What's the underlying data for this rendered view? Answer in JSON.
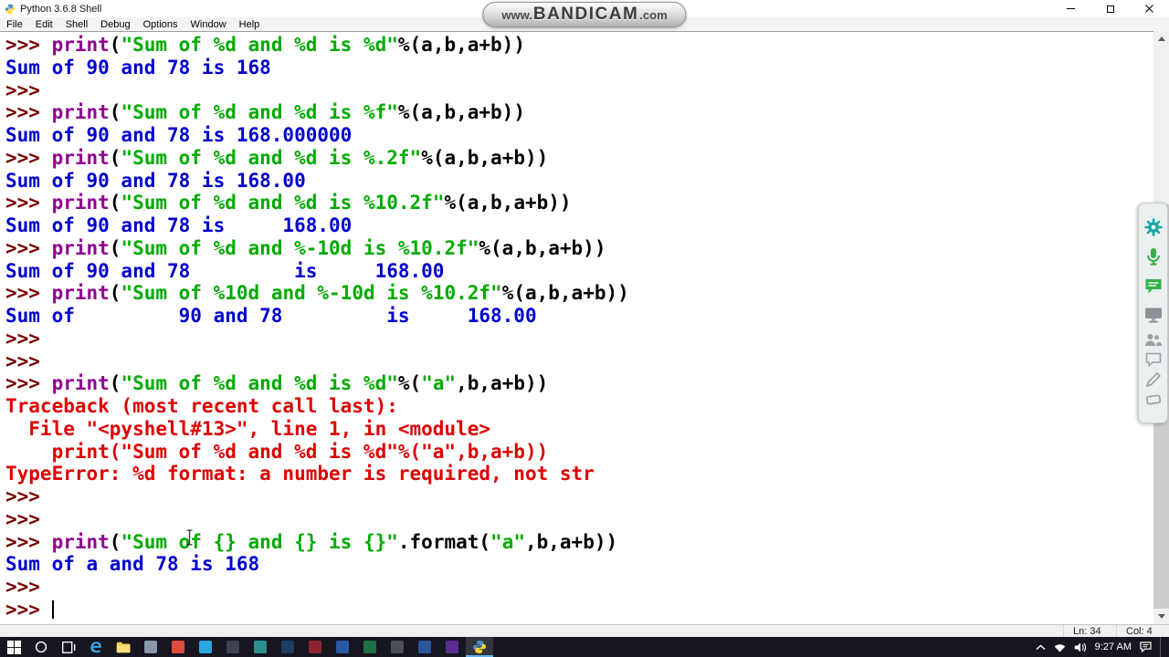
{
  "window": {
    "title": "Python 3.6.8 Shell"
  },
  "menu": {
    "items": [
      "File",
      "Edit",
      "Shell",
      "Debug",
      "Options",
      "Window",
      "Help"
    ]
  },
  "watermark": {
    "prefix": "www.",
    "brand": "BANDICAM",
    "suffix": ".com"
  },
  "colors": {
    "prompt": "#770000",
    "builtin": "#900090",
    "string": "#00aa00",
    "stdout": "#0000cd",
    "stderr": "#dd0000",
    "plain": "#000000",
    "taskbar_bg": "#161621",
    "accent_active": "#5fb2e8"
  },
  "shell": {
    "cursor_line": 25,
    "lines": [
      [
        {
          "t": ">>> ",
          "c": "p"
        },
        {
          "t": "print",
          "c": "b"
        },
        {
          "t": "(",
          "c": "n"
        },
        {
          "t": "\"Sum of %d and %d is %d\"",
          "c": "s"
        },
        {
          "t": "%(a,b,a+b))",
          "c": "n"
        }
      ],
      [
        {
          "t": "Sum of 90 and 78 is 168",
          "c": "o"
        }
      ],
      [
        {
          "t": ">>> ",
          "c": "p"
        }
      ],
      [
        {
          "t": ">>> ",
          "c": "p"
        },
        {
          "t": "print",
          "c": "b"
        },
        {
          "t": "(",
          "c": "n"
        },
        {
          "t": "\"Sum of %d and %d is %f\"",
          "c": "s"
        },
        {
          "t": "%(a,b,a+b))",
          "c": "n"
        }
      ],
      [
        {
          "t": "Sum of 90 and 78 is 168.000000",
          "c": "o"
        }
      ],
      [
        {
          "t": ">>> ",
          "c": "p"
        },
        {
          "t": "print",
          "c": "b"
        },
        {
          "t": "(",
          "c": "n"
        },
        {
          "t": "\"Sum of %d and %d is %.2f\"",
          "c": "s"
        },
        {
          "t": "%(a,b,a+b))",
          "c": "n"
        }
      ],
      [
        {
          "t": "Sum of 90 and 78 is 168.00",
          "c": "o"
        }
      ],
      [
        {
          "t": ">>> ",
          "c": "p"
        },
        {
          "t": "print",
          "c": "b"
        },
        {
          "t": "(",
          "c": "n"
        },
        {
          "t": "\"Sum of %d and %d is %10.2f\"",
          "c": "s"
        },
        {
          "t": "%(a,b,a+b))",
          "c": "n"
        }
      ],
      [
        {
          "t": "Sum of 90 and 78 is     168.00",
          "c": "o"
        }
      ],
      [
        {
          "t": ">>> ",
          "c": "p"
        },
        {
          "t": "print",
          "c": "b"
        },
        {
          "t": "(",
          "c": "n"
        },
        {
          "t": "\"Sum of %d and %-10d is %10.2f\"",
          "c": "s"
        },
        {
          "t": "%(a,b,a+b))",
          "c": "n"
        }
      ],
      [
        {
          "t": "Sum of 90 and 78         is     168.00",
          "c": "o"
        }
      ],
      [
        {
          "t": ">>> ",
          "c": "p"
        },
        {
          "t": "print",
          "c": "b"
        },
        {
          "t": "(",
          "c": "n"
        },
        {
          "t": "\"Sum of %10d and %-10d is %10.2f\"",
          "c": "s"
        },
        {
          "t": "%(a,b,a+b))",
          "c": "n"
        }
      ],
      [
        {
          "t": "Sum of         90 and 78         is     168.00",
          "c": "o"
        }
      ],
      [
        {
          "t": ">>> ",
          "c": "p"
        }
      ],
      [
        {
          "t": ">>> ",
          "c": "p"
        }
      ],
      [
        {
          "t": ">>> ",
          "c": "p"
        },
        {
          "t": "print",
          "c": "b"
        },
        {
          "t": "(",
          "c": "n"
        },
        {
          "t": "\"Sum of %d and %d is %d\"",
          "c": "s"
        },
        {
          "t": "%(",
          "c": "n"
        },
        {
          "t": "\"a\"",
          "c": "s"
        },
        {
          "t": ",b,a+b))",
          "c": "n"
        }
      ],
      [
        {
          "t": "Traceback (most recent call last):",
          "c": "e"
        }
      ],
      [
        {
          "t": "  File \"<pyshell#13>\", line 1, in <module>",
          "c": "e"
        }
      ],
      [
        {
          "t": "    print(\"Sum of %d and %d is %d\"%(\"a\",b,a+b))",
          "c": "e"
        }
      ],
      [
        {
          "t": "TypeError: %d format: a number is required, not str",
          "c": "e"
        }
      ],
      [
        {
          "t": ">>> ",
          "c": "p"
        }
      ],
      [
        {
          "t": ">>> ",
          "c": "p"
        }
      ],
      [
        {
          "t": ">>> ",
          "c": "p"
        },
        {
          "t": "print",
          "c": "b"
        },
        {
          "t": "(",
          "c": "n"
        },
        {
          "t": "\"Sum of {} and {} is {}\"",
          "c": "s"
        },
        {
          "t": ".format(",
          "c": "n"
        },
        {
          "t": "\"a\"",
          "c": "s"
        },
        {
          "t": ",b,a+b))",
          "c": "n"
        }
      ],
      [
        {
          "t": "Sum of a and 78 is 168",
          "c": "o"
        }
      ],
      [
        {
          "t": ">>> ",
          "c": "p"
        }
      ],
      [
        {
          "t": ">>> ",
          "c": "p"
        }
      ]
    ]
  },
  "status": {
    "ln": "Ln: 34",
    "col": "Col: 4"
  },
  "annotation_toolbar": {
    "icons": [
      {
        "name": "gear-icon",
        "color": "#1ba8a8"
      },
      {
        "name": "mic-icon",
        "color": "#35b24a"
      },
      {
        "name": "chat-icon",
        "color": "#35b24a"
      },
      {
        "name": "screen-share-icon",
        "color": "#8b9196"
      },
      {
        "name": "people-icon",
        "color": "#9aa0a6"
      },
      {
        "name": "speech-bubble-icon",
        "color": "#9aa0a6"
      },
      {
        "name": "pencil-icon",
        "color": "#9aa0a6"
      },
      {
        "name": "eraser-icon",
        "color": "#9aa0a6"
      }
    ]
  },
  "taskbar": {
    "system": [
      {
        "name": "start-button",
        "icon": "windows-logo"
      },
      {
        "name": "search-button",
        "icon": "search-circle"
      },
      {
        "name": "task-view-button",
        "icon": "task-view"
      }
    ],
    "apps": [
      {
        "name": "edge",
        "icon": "edge",
        "color": "#35a7e8"
      },
      {
        "name": "file-explorer",
        "icon": "folder",
        "color": "#f2c94c"
      },
      {
        "name": "app-gray",
        "icon": "app",
        "color": "#8796a8"
      },
      {
        "name": "app-red",
        "icon": "app",
        "color": "#e04b3a"
      },
      {
        "name": "app-skype",
        "icon": "app",
        "color": "#28a7e0"
      },
      {
        "name": "app-dark",
        "icon": "app",
        "color": "#3c4250"
      },
      {
        "name": "app-teal",
        "icon": "app",
        "color": "#2a8f8f"
      },
      {
        "name": "app-navy",
        "icon": "app",
        "color": "#1d3d63"
      },
      {
        "name": "app-maroon",
        "icon": "app",
        "color": "#8d2330"
      },
      {
        "name": "app-blue",
        "icon": "app",
        "color": "#2a5aa5"
      },
      {
        "name": "app-green",
        "icon": "app",
        "color": "#1e7145"
      },
      {
        "name": "app-slate",
        "icon": "app",
        "color": "#4a4f5a"
      },
      {
        "name": "app-word",
        "icon": "app",
        "color": "#2b579a"
      },
      {
        "name": "app-violet",
        "icon": "app",
        "color": "#5c2d91"
      },
      {
        "name": "idle-python",
        "icon": "idle",
        "color": "#4b8bbe",
        "active": true
      }
    ],
    "tray": {
      "time": "9:27 AM",
      "icons": [
        "chevron-up-icon",
        "network-icon",
        "volume-icon"
      ],
      "right_icon": "action-center-icon"
    }
  }
}
